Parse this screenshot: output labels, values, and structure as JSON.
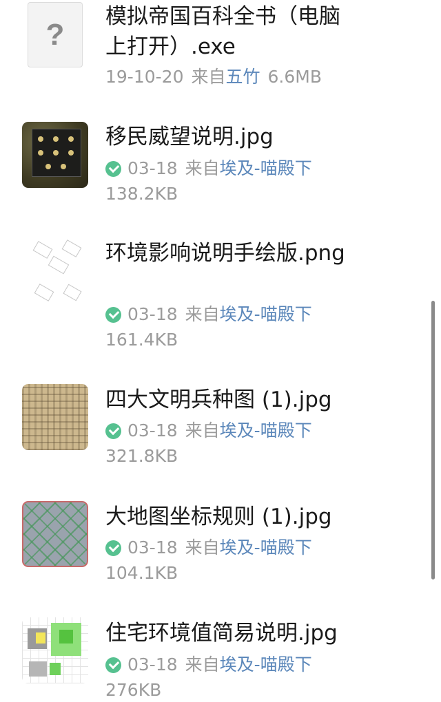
{
  "files": [
    {
      "thumb_icon": "unknown-file-icon",
      "thumb_glyph": "?",
      "name": "模拟帝国百科全书（电脑上打开）.exe",
      "date": "19-10-20",
      "from_label": "来自",
      "sender": "五竹",
      "size": "6.6MB",
      "downloaded": false
    },
    {
      "thumb_icon": "image-thumbnail",
      "name": "移民威望说明.jpg",
      "date": "03-18",
      "from_label": "来自",
      "sender": "埃及-喵殿下",
      "size": "138.2KB",
      "downloaded": true
    },
    {
      "thumb_icon": "image-thumbnail",
      "name": "环境影响说明手绘版.png",
      "date": "03-18",
      "from_label": "来自",
      "sender": "埃及-喵殿下",
      "size": "161.4KB",
      "downloaded": true
    },
    {
      "thumb_icon": "image-thumbnail",
      "name": "四大文明兵种图 (1).jpg",
      "date": "03-18",
      "from_label": "来自",
      "sender": "埃及-喵殿下",
      "size": "321.8KB",
      "downloaded": true
    },
    {
      "thumb_icon": "image-thumbnail",
      "name": "大地图坐标规则 (1).jpg",
      "date": "03-18",
      "from_label": "来自",
      "sender": "埃及-喵殿下",
      "size": "104.1KB",
      "downloaded": true
    },
    {
      "thumb_icon": "image-thumbnail",
      "name": "住宅环境值简易说明.jpg",
      "date": "03-18",
      "from_label": "来自",
      "sender": "埃及-喵殿下",
      "size": "276KB",
      "downloaded": true
    }
  ],
  "colors": {
    "sender_link": "#5b87ba",
    "meta_gray": "#9b9b9b",
    "downloaded_check": "#56c190"
  }
}
